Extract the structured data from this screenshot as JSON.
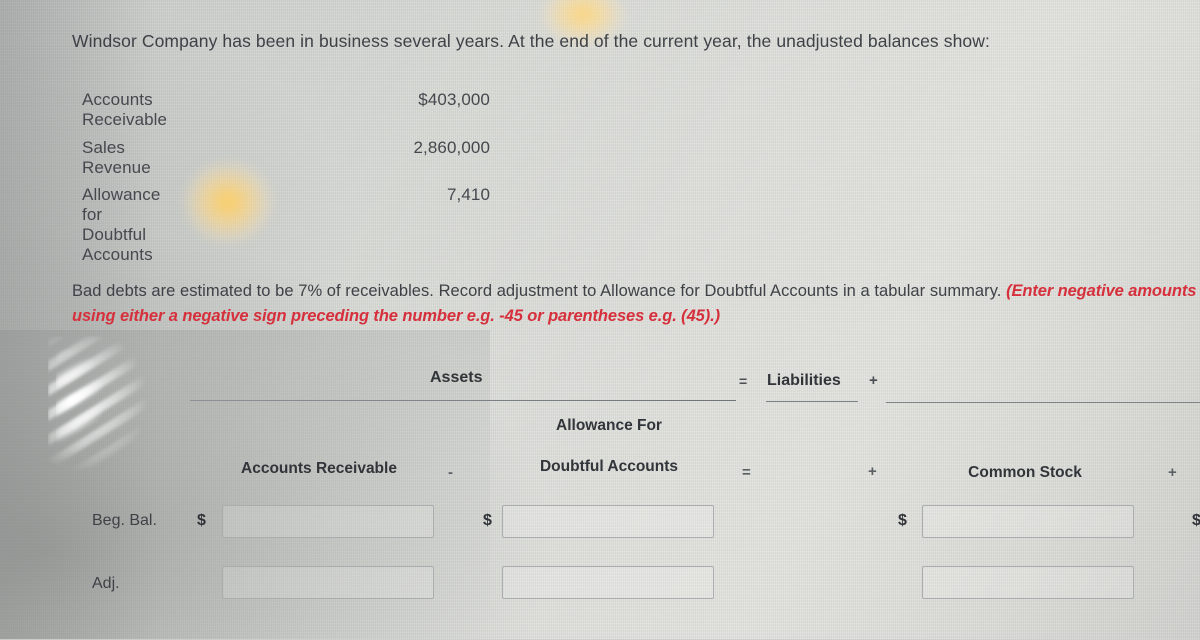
{
  "problem": {
    "intro": "Windsor Company has been in business several years. At the end of the current year, the unadjusted balances show:",
    "balances": [
      {
        "account": "Accounts Receivable",
        "amount": "$403,000"
      },
      {
        "account": "Sales Revenue",
        "amount": "2,860,000"
      },
      {
        "account": "Allowance for Doubtful Accounts",
        "amount": "7,410"
      }
    ],
    "task_plain": "Bad debts are estimated to be 7% of receivables. Record adjustment to Allowance for Doubtful Accounts in a tabular summary. ",
    "task_emphasis": "(Enter negative amounts using either a negative sign preceding the number e.g. -45 or parentheses e.g. (45).)"
  },
  "summary_table": {
    "group_headers": {
      "assets": "Assets",
      "liabilities": "Liabilities",
      "equals_operator": "=",
      "plus_operator": "+"
    },
    "column_headers": {
      "accounts_receivable": "Accounts Receivable",
      "allowance_line1": "Allowance For",
      "allowance_line2": "Doubtful Accounts",
      "common_stock": "Common Stock"
    },
    "operators": {
      "minus": "-",
      "equals": "=",
      "plus": "+",
      "plus_right": "+"
    },
    "currency_symbol": "$",
    "rows": [
      {
        "label": "Beg. Bal.",
        "accounts_receivable": "",
        "allowance_doubtful": "",
        "common_stock": ""
      },
      {
        "label": "Adj.",
        "accounts_receivable": "",
        "allowance_doubtful": "",
        "common_stock": ""
      }
    ]
  },
  "colors": {
    "emphasis_red": "#d6303c",
    "body_text": "#3e4247",
    "screen_background": "#dcdcd8"
  }
}
